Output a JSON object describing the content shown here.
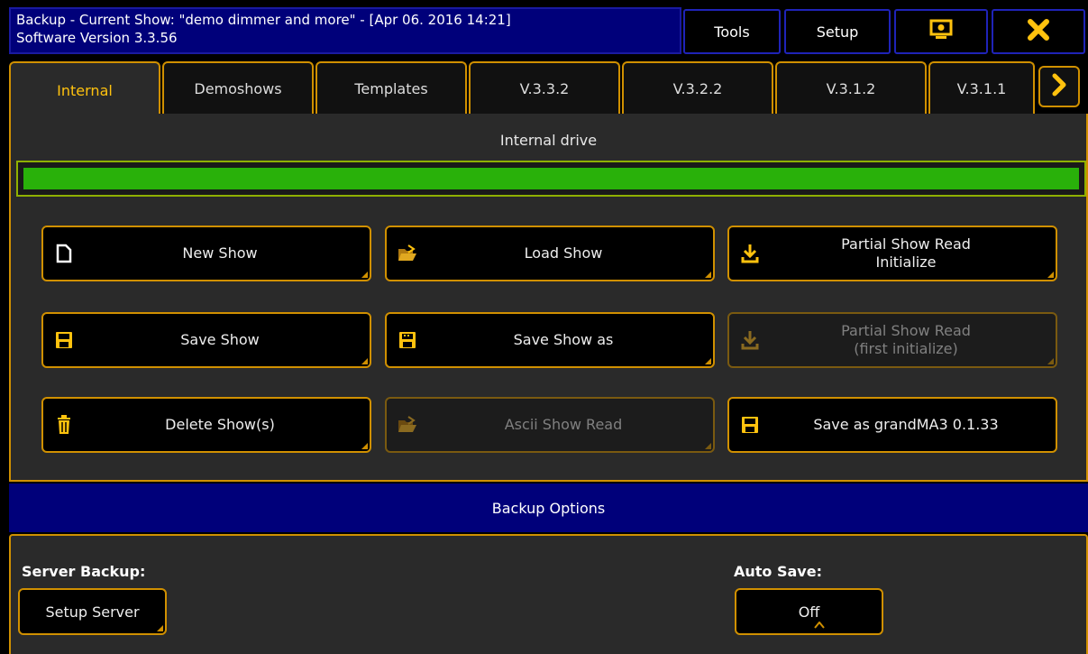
{
  "titlebar": {
    "line1": "Backup - Current Show: \"demo dimmer and more\"  -  [Apr 06. 2016 14:21]",
    "line2": "Software Version 3.3.56",
    "tools_label": "Tools",
    "setup_label": "Setup",
    "display_icon": "monitor-icon",
    "close_icon": "close-icon"
  },
  "tabs": [
    {
      "label": "Internal",
      "active": true
    },
    {
      "label": "Demoshows",
      "active": false
    },
    {
      "label": "Templates",
      "active": false
    },
    {
      "label": "V.3.3.2",
      "active": false
    },
    {
      "label": "V.3.2.2",
      "active": false
    },
    {
      "label": "V.3.1.2",
      "active": false
    },
    {
      "label": "V.3.1.1",
      "active": false
    }
  ],
  "tab_scroll_icon": "chevron-right-icon",
  "drive": {
    "label": "Internal drive",
    "fill_fraction": 1.0,
    "fill_color": "#29b10a"
  },
  "actions": {
    "new_show": {
      "label": "New Show",
      "icon": "new-file-icon",
      "enabled": true
    },
    "load_show": {
      "label": "Load Show",
      "icon": "open-folder-icon",
      "enabled": true
    },
    "partial_init": {
      "label": "Partial Show Read\nInitialize",
      "icon": "download-arrow-icon",
      "enabled": true
    },
    "save_show": {
      "label": "Save Show",
      "icon": "floppy-disk-icon",
      "enabled": true
    },
    "save_show_as": {
      "label": "Save Show as",
      "icon": "floppy-disk-icon",
      "enabled": true
    },
    "partial_read": {
      "label": "Partial Show Read\n(first initialize)",
      "icon": "download-arrow-icon",
      "enabled": false
    },
    "delete_show": {
      "label": "Delete Show(s)",
      "icon": "trash-icon",
      "enabled": true
    },
    "ascii_read": {
      "label": "Ascii Show Read",
      "icon": "open-folder-icon",
      "enabled": false
    },
    "save_ma3": {
      "label": "Save as grandMA3 0.1.33",
      "icon": "floppy-disk-icon",
      "enabled": true
    }
  },
  "options": {
    "header": "Backup Options",
    "server_label": "Server Backup:",
    "server_button": "Setup Server",
    "autosave_label": "Auto Save:",
    "autosave_value": "Off"
  },
  "colors": {
    "accent": "#d09000",
    "title_bg": "#00007a",
    "active_tab_text": "#ffc20e"
  }
}
